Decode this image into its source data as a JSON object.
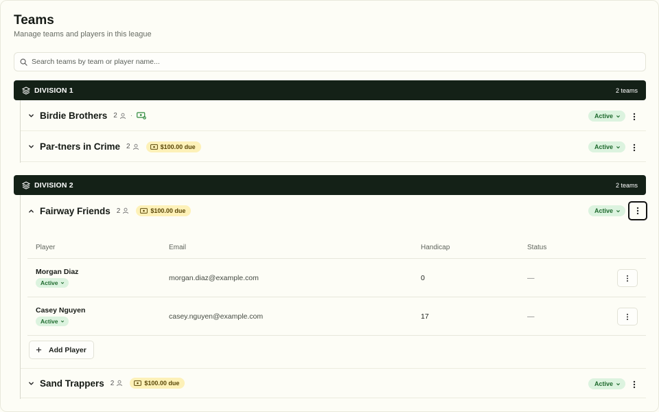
{
  "page": {
    "title": "Teams",
    "subtitle": "Manage teams and players in this league"
  },
  "search": {
    "placeholder": "Search teams by team or player name..."
  },
  "divisions": [
    {
      "name": "DIVISION 1",
      "count_label": "2 teams",
      "teams": [
        {
          "name": "Birdie Brothers",
          "members": "2",
          "paid": true,
          "status": "Active",
          "expanded": false
        },
        {
          "name": "Par-tners in Crime",
          "members": "2",
          "due": "$100.00 due",
          "status": "Active",
          "expanded": false
        }
      ]
    },
    {
      "name": "DIVISION 2",
      "count_label": "2 teams",
      "teams": [
        {
          "name": "Fairway Friends",
          "members": "2",
          "due": "$100.00 due",
          "status": "Active",
          "expanded": true
        },
        {
          "name": "Sand Trappers",
          "members": "2",
          "due": "$100.00 due",
          "status": "Active",
          "expanded": false
        }
      ]
    }
  ],
  "dot_separator": "·",
  "players_table": {
    "columns": [
      "Player",
      "Email",
      "Handicap",
      "Status"
    ],
    "rows": [
      {
        "name": "Morgan Diaz",
        "status": "Active",
        "email": "morgan.diaz@example.com",
        "handicap": "0",
        "status_col": "—"
      },
      {
        "name": "Casey Nguyen",
        "status": "Active",
        "email": "casey.nguyen@example.com",
        "handicap": "17",
        "status_col": "—"
      }
    ],
    "add_label": "Add Player"
  },
  "colors": {
    "division_bg": "#142117",
    "active_bg": "#dcf3df",
    "active_text": "#1f6a2e",
    "due_bg": "#fdf1b8",
    "due_text": "#5a4708"
  }
}
